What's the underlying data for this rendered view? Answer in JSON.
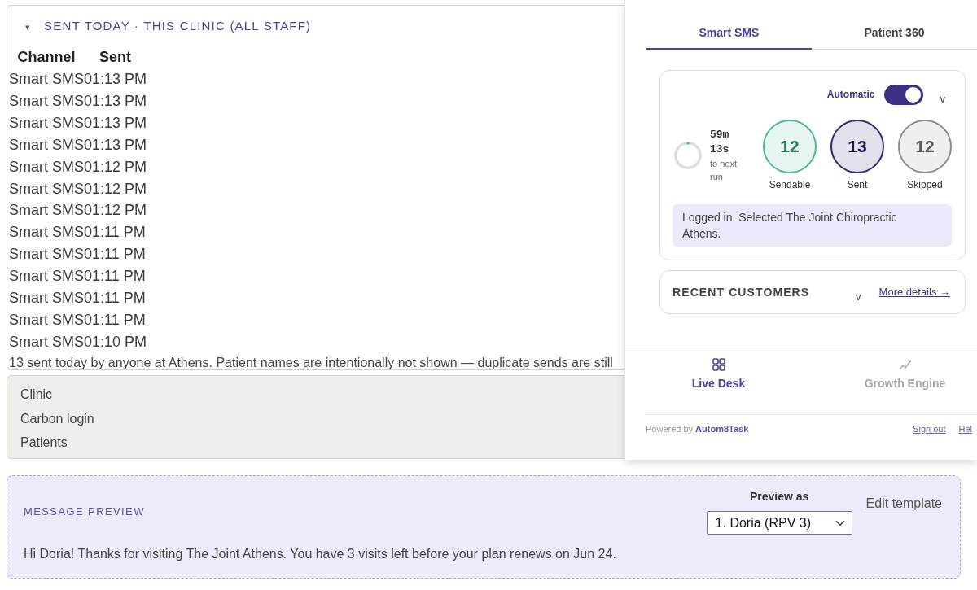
{
  "sent_today": {
    "disclosure": "▾",
    "title": "SENT TODAY · THIS CLINIC (ALL STAFF)",
    "columns": [
      "Channel",
      "Sent"
    ],
    "rows": [
      {
        "channel": "Smart SMS",
        "sent": "01:13 PM"
      },
      {
        "channel": "Smart SMS",
        "sent": "01:13 PM"
      },
      {
        "channel": "Smart SMS",
        "sent": "01:13 PM"
      },
      {
        "channel": "Smart SMS",
        "sent": "01:13 PM"
      },
      {
        "channel": "Smart SMS",
        "sent": "01:12 PM"
      },
      {
        "channel": "Smart SMS",
        "sent": "01:12 PM"
      },
      {
        "channel": "Smart SMS",
        "sent": "01:12 PM"
      },
      {
        "channel": "Smart SMS",
        "sent": "01:11 PM"
      },
      {
        "channel": "Smart SMS",
        "sent": "01:11 PM"
      },
      {
        "channel": "Smart SMS",
        "sent": "01:11 PM"
      },
      {
        "channel": "Smart SMS",
        "sent": "01:11 PM"
      },
      {
        "channel": "Smart SMS",
        "sent": "01:11 PM"
      },
      {
        "channel": "Smart SMS",
        "sent": "01:10 PM"
      }
    ],
    "footnote": "13 sent today by anyone at Athens. Patient names are intentionally not shown — duplicate sends are still"
  },
  "details": {
    "items": [
      "Clinic",
      "Carbon login",
      "Patients"
    ]
  },
  "panel": {
    "tabs": [
      {
        "label": "Smart SMS",
        "selected": true
      },
      {
        "label": "Patient 360",
        "selected": false
      }
    ],
    "automation": {
      "label": "Automatic",
      "on": true,
      "chevron": "v"
    },
    "countdown": {
      "time": "59m 13s",
      "caption": "to next run"
    },
    "stats": [
      {
        "value": "12",
        "label": "Sendable",
        "color": "#4db89b"
      },
      {
        "value": "13",
        "label": "Sent",
        "color": "#2e2a72"
      },
      {
        "value": "12",
        "label": "Skipped",
        "color": "#8c8a94"
      }
    ],
    "status": "Logged in. Selected The Joint Chiropractic Athens.",
    "recent_customers": {
      "title": "RECENT CUSTOMERS",
      "chevron": "v",
      "link": "More details →"
    },
    "nav": [
      {
        "label": "Live Desk",
        "selected": true
      },
      {
        "label": "Growth Engine",
        "selected": false
      }
    ],
    "footer": {
      "powered_by": "Powered by",
      "brand": "Autom8Task",
      "links": [
        "Sign out",
        "Hel"
      ]
    }
  },
  "message_preview": {
    "title": "MESSAGE PREVIEW",
    "preview_as_label": "Preview as",
    "preview_as": {
      "value": "1. Doria (RPV 3)"
    },
    "edit_link": "Edit template",
    "message": "Hi Doria! Thanks for visiting The Joint Athens. You have 3 visits left before your plan renews on Jun 24."
  }
}
